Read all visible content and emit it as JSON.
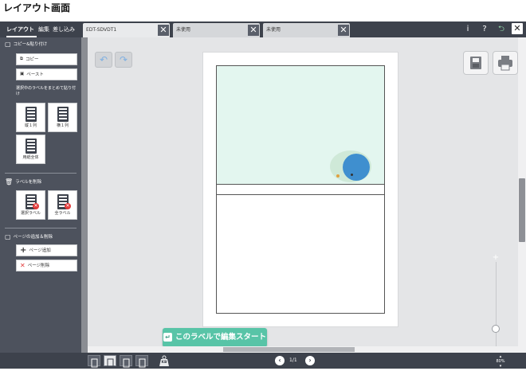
{
  "caption": "レイアウト画面",
  "nav": {
    "tabs": [
      {
        "label": "レイアウト",
        "active": true
      },
      {
        "label": "編集",
        "active": false
      },
      {
        "label": "差し込み",
        "active": false
      }
    ]
  },
  "doc_tabs": [
    {
      "label": "EDT-SDVDT1",
      "close": "✕"
    },
    {
      "label": "未使用",
      "close": "✕"
    },
    {
      "label": "未使用",
      "close": "✕"
    }
  ],
  "toolbar": {
    "info": "i",
    "help": "?",
    "back": "⮌",
    "close": "✕"
  },
  "sidebar": {
    "copy_section": "コピー&貼り付け",
    "copy": "コピー",
    "paste": "ペースト",
    "batch_note": "選択中のラベルをまとめて貼り付け",
    "vertical": "縦１列",
    "horizontal": "横１列",
    "whole": "用紙全体",
    "delete_section": "ラベルを削除",
    "delete_selected": "選択ラベル",
    "delete_all": "全ラベル",
    "page_section": "ページの追加＆削除",
    "page_add": "ページ追加",
    "page_delete": "ページ削除"
  },
  "canvas": {
    "start_button": "このラベルで編集スタート",
    "zoom_plus": "+",
    "zoom_minus": "−"
  },
  "bottom": {
    "page": "1/1",
    "prev": "‹",
    "next": "›",
    "zoom": "80%",
    "weight_badge": "KB"
  },
  "colors": {
    "accent_green": "#58c4a7",
    "label_mint": "#e3f6ef",
    "dark_bar": "#3d424c"
  }
}
